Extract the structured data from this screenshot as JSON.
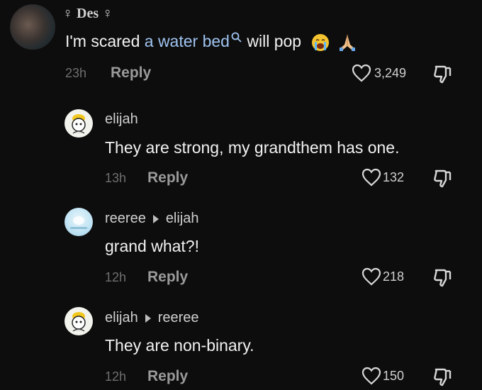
{
  "comment": {
    "author": "Des",
    "text_before": "I'm scared ",
    "link_text": "a water bed",
    "text_after": " will pop",
    "emojis": [
      "crying-face",
      "folded-hands"
    ],
    "time": "23h",
    "reply_label": "Reply",
    "likes": "3,249"
  },
  "replies": [
    {
      "author": "elijah",
      "reply_to": "",
      "text": "They are strong, my grandthem has one.",
      "time": "13h",
      "reply_label": "Reply",
      "likes": "132"
    },
    {
      "author": "reeree",
      "reply_to": "elijah",
      "text": "grand what?!",
      "time": "12h",
      "reply_label": "Reply",
      "likes": "218"
    },
    {
      "author": "elijah",
      "reply_to": "reeree",
      "text": "They are non-binary.",
      "time": "12h",
      "reply_label": "Reply",
      "likes": "150"
    }
  ],
  "colors": {
    "background": "#0d0d0d",
    "link": "#9fc3f0",
    "muted": "#6f6f6f"
  }
}
